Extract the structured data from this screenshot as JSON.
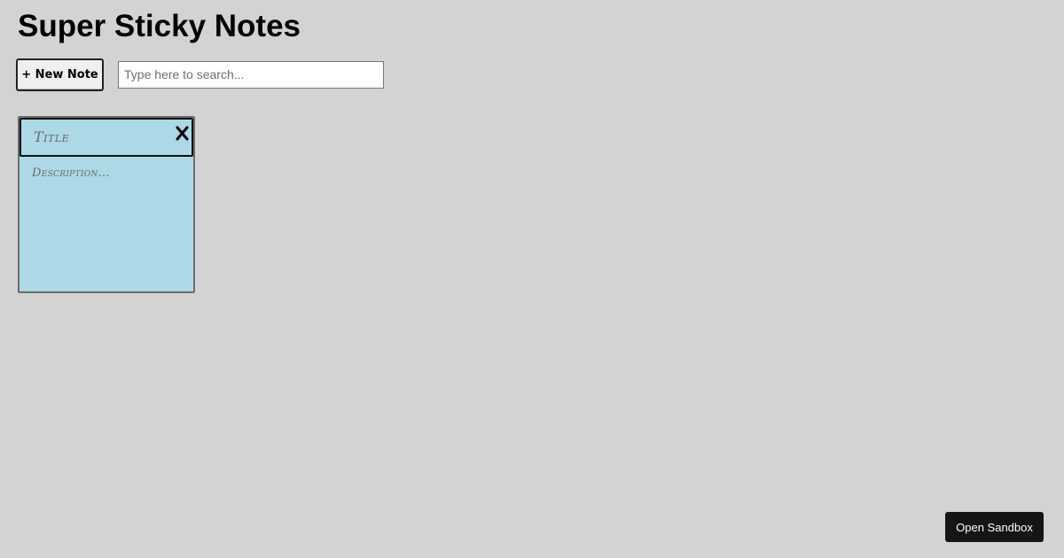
{
  "app": {
    "title": "Super Sticky Notes"
  },
  "toolbar": {
    "new_note_label": "+ New Note",
    "search_placeholder": "Type here to search...",
    "search_value": ""
  },
  "notes": [
    {
      "title": "Title",
      "description": "Description...",
      "color": "#add8e6",
      "close_icon": "close-icon"
    }
  ],
  "footer": {
    "sandbox_label": "Open Sandbox"
  },
  "colors": {
    "background": "#d3d3d3",
    "note": "#add8e6",
    "sandbox_button": "#151515"
  }
}
